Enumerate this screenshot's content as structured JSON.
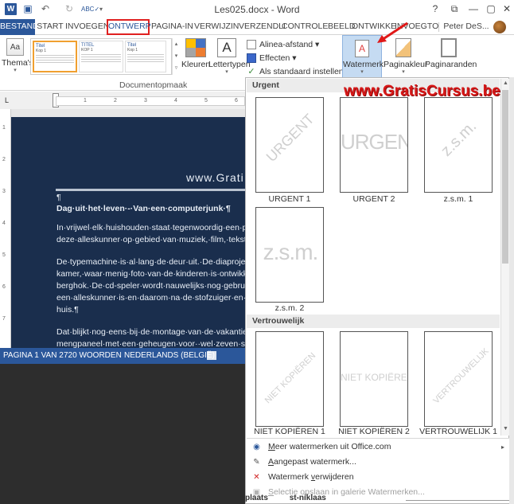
{
  "titlebar": {
    "title": "Les025.docx - Word",
    "help": "?",
    "restore_ribbon": "⧉",
    "minimize": "—",
    "maximize": "▢",
    "close": "✕",
    "word_logo": "W",
    "save_icon": "floppy-icon",
    "undo": "↶",
    "redo": "↻",
    "spell": "ABC✓",
    "qat_more": "▾"
  },
  "tabs": [
    {
      "label": "BESTAND"
    },
    {
      "label": "START"
    },
    {
      "label": "INVOEGEN"
    },
    {
      "label": "ONTWERP"
    },
    {
      "label": "PAGINA-IN"
    },
    {
      "label": "VERWIJZIN"
    },
    {
      "label": "VERZENDLI"
    },
    {
      "label": "CONTROLE"
    },
    {
      "label": "BEELD"
    },
    {
      "label": "ONTWIKKE"
    },
    {
      "label": "INVOEGTO"
    },
    {
      "label": "Peter DeS..."
    }
  ],
  "ribbon": {
    "themes": {
      "icon_text": "Aa",
      "label": "Thema's",
      "arrow": "▾"
    },
    "gallery": [
      {
        "title": "Titel",
        "sub": "Kop 1"
      },
      {
        "title": "TITEL",
        "sub": "KOP 1"
      },
      {
        "title": "Titel",
        "sub": "Kop 1"
      }
    ],
    "gallery_scroll": [
      "▴",
      "▾",
      "▿"
    ],
    "colors_label": "Kleuren",
    "fonts": {
      "icon_text": "A",
      "label": "Lettertypen",
      "arrow": "▾"
    },
    "paragraph_spacing": "Alinea-afstand ▾",
    "effects": "Effecten ▾",
    "set_default": "Als standaard instellen",
    "check": "✓",
    "watermark": {
      "label": "Watermerk",
      "icon": "A",
      "arrow": "▾"
    },
    "page_color": {
      "label": "Paginakleur",
      "arrow": "▾"
    },
    "page_borders": "Paginaranden",
    "group_label": "Documentopmaak",
    "collapse": "▴"
  },
  "ruler": {
    "tab_icon": "L",
    "h_ticks": [
      "1",
      "2",
      "3",
      "4",
      "5",
      "6"
    ],
    "v_ticks": [
      "1",
      "2",
      "3",
      "4",
      "5",
      "6",
      "7"
    ]
  },
  "document": {
    "header": "www.Grati",
    "lines": [
      "¶",
      "Dag·uit·het·leven·-·Van·een·computerjunk·¶",
      "In·vrijwel·elk·huishouden·staat·tegenwoordig·een·p",
      "deze·alleskunner·op·gebied·van·muziek,·film,·tekst·",
      "De·typemachine·is·al·lang·de·deur·uit.·De·diaprojec",
      "kamer,·waar·menig·foto·van·de·kinderen·is·ontwikk",
      "berghok.·De·cd-speler·wordt·nauwelijks·nog·gebrui",
      "een·alleskunner·is·en·daarom·na·de·stofzuiger·en·d",
      "huis.¶",
      "Dat·blijkt·nog·eens·bij·de·montage·van·de·vakantie",
      "mengpaneel·met·een·geheugen·voor··wel·zeven·sc"
    ]
  },
  "statusbar": {
    "page": "PAGINA 1 VAN 2",
    "words": "720 WOORDEN",
    "language": "NEDERLANDS (BELGIË)"
  },
  "panel": {
    "sections": [
      {
        "title": "Urgent"
      },
      {
        "title": "Vertrouwelijk"
      }
    ],
    "watermarks": [
      {
        "caption": "URGENT 1",
        "text": "URGENT"
      },
      {
        "caption": "URGENT 2",
        "text": "URGENT"
      },
      {
        "caption": "z.s.m. 1",
        "text": "z.s.m."
      },
      {
        "caption": "z.s.m. 2",
        "text": "z.s.m."
      },
      {
        "caption": "NIET KOPIËREN 1",
        "text": "NIET KOPIËREN"
      },
      {
        "caption": "NIET KOPIËREN 2",
        "text": "NIET KOPIËREN"
      },
      {
        "caption": "VERTROUWELIJK 1",
        "text": "VERTROUWELIJK"
      }
    ],
    "scroll_up": "▲",
    "scroll_down": "▼",
    "menu": [
      {
        "label": "Meer watermerken uit Office.com",
        "accel": "M",
        "rest": "eer watermerken uit Office.com",
        "arrow": "▸"
      },
      {
        "label": "Aangepast watermerk...",
        "accel": "A",
        "rest": "angepast watermerk..."
      },
      {
        "label": "Watermerk verwijderen",
        "pre": "Watermerk ",
        "accel": "v",
        "rest": "erwijderen"
      },
      {
        "label": "Selectie opslaan in galerie Watermerken...",
        "accel": "S",
        "rest": "electie opslaan in galerie Watermerken..."
      }
    ],
    "menu_icons": [
      "globe-doc",
      "doc-edit",
      "doc-remove",
      "doc-save"
    ],
    "menu_icon_glyphs": [
      "◉",
      "✎",
      "✕",
      "▣"
    ]
  },
  "overlay_brand": "www.GratisCursus.be",
  "bottom_partial": {
    "a": "plaats",
    "b": "st-niklaas"
  },
  "colors": {
    "accent": "#2b579a",
    "highlight_red": "#d81818",
    "page_bg": "#1a2e4d",
    "watermark_btn_bg": "#c5dbf2"
  }
}
